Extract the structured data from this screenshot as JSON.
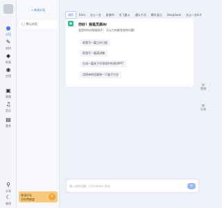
{
  "rail": {
    "items": [
      {
        "label": "对话",
        "icon": "chat-icon",
        "glyph": "●"
      },
      {
        "label": "创作",
        "icon": "pen-icon",
        "glyph": "✎"
      },
      {
        "label": "绘画",
        "icon": "brush-icon",
        "glyph": "◆"
      },
      {
        "label": "应用",
        "icon": "apps-icon",
        "glyph": "◉"
      },
      {
        "label": "视频",
        "icon": "video-icon",
        "glyph": "▣"
      },
      {
        "label": "音乐",
        "icon": "music-icon",
        "glyph": "♫"
      },
      {
        "label": "更多",
        "icon": "more-icon",
        "glyph": "▤"
      }
    ],
    "bottom": [
      {
        "label": "分享",
        "icon": "share-icon",
        "glyph": "⚲"
      },
      {
        "label": "夜间",
        "icon": "moon-icon",
        "glyph": "☾"
      }
    ]
  },
  "sidebar": {
    "new_chat": "+ 新建对话",
    "conversation": "默认对话",
    "promo_line1": "邀请好友",
    "promo_line2": "领免费额度",
    "promo_badge": "¥"
  },
  "tabs": [
    "通用",
    "Kimi",
    "文心一言",
    "智谱AI",
    "讯飞星火",
    "通义千问",
    "腾讯混元",
    "DeepSeek",
    "文心一言4.0"
  ],
  "active_tab_index": 0,
  "chat": {
    "greeting": "你好！我是灵犀AI",
    "intro": "我是你的AI智能助手，可以为你解答各种问题！",
    "suggestions": [
      "帮我写一篇工作日报",
      "帮我写一篇演讲稿",
      "生成一篇关于环境保护的演讲PPT",
      "用简单的话解释一下量子力学"
    ]
  },
  "tools": [
    {
      "label": "客服",
      "icon": "service-icon"
    },
    {
      "label": "反馈",
      "icon": "feedback-icon"
    }
  ],
  "composer": {
    "placeholder": "输入你的问题，Ctrl+Enter 发送",
    "send_label": "➤"
  },
  "colors": {
    "accent": "#4c7cf3",
    "bot": "#2ec08a",
    "promo": "#f6c97c"
  }
}
